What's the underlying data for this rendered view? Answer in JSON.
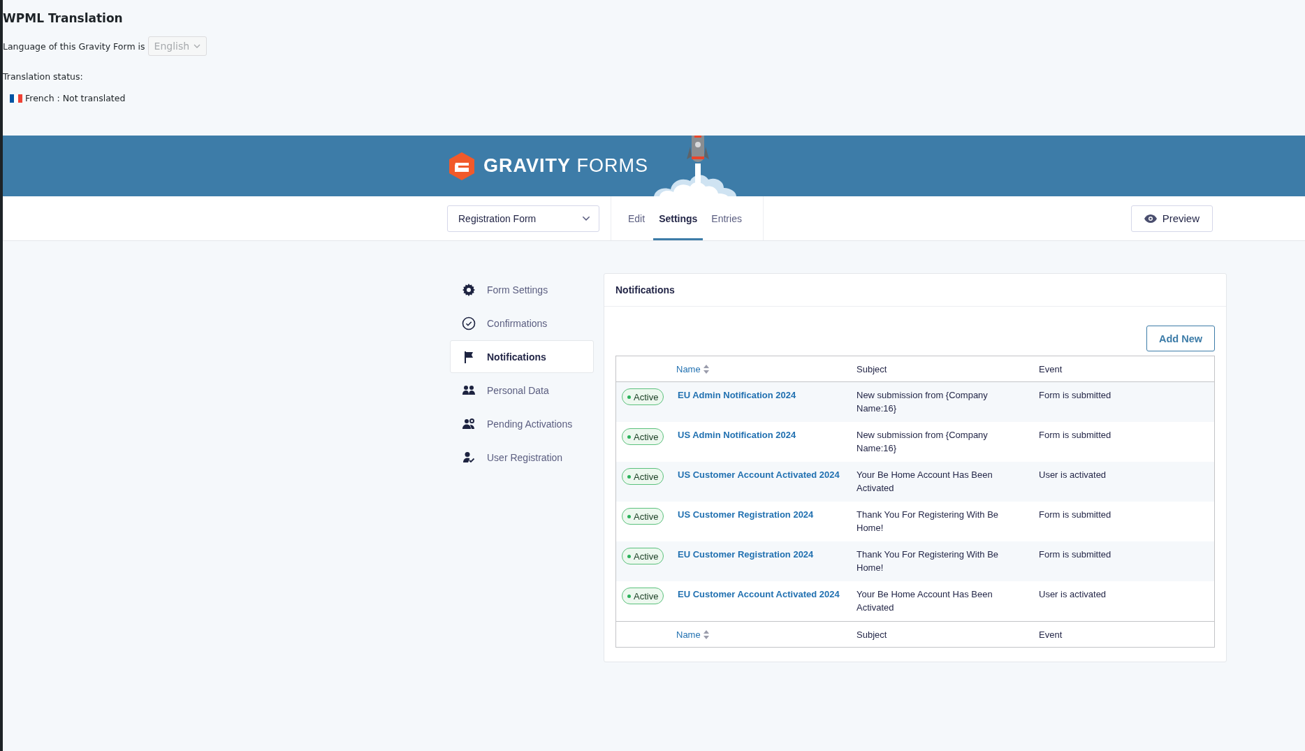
{
  "wpml": {
    "title": "WPML Translation",
    "language_label": "Language of this Gravity Form is",
    "language_select": {
      "value": "English",
      "disabled": true
    },
    "status_label": "Translation status:",
    "translations": [
      {
        "label": "French : Not translated"
      }
    ]
  },
  "header": {
    "logo_bold": "GRAVITY",
    "logo_light": "FORMS"
  },
  "toolbar": {
    "form_select": "Registration Form",
    "tabs": [
      {
        "label": "Edit",
        "selected": false
      },
      {
        "label": "Settings",
        "selected": true
      },
      {
        "label": "Entries",
        "selected": false
      }
    ],
    "preview": "Preview"
  },
  "sidebar": {
    "items": [
      {
        "label": "Form Settings",
        "kind": "gear",
        "selected": false
      },
      {
        "label": "Confirmations",
        "kind": "check",
        "selected": false
      },
      {
        "label": "Notifications",
        "kind": "flag",
        "selected": true
      },
      {
        "label": "Personal Data",
        "kind": "people",
        "selected": false
      },
      {
        "label": "Pending Activations",
        "kind": "people-clock",
        "selected": false
      },
      {
        "label": "User Registration",
        "kind": "user-check",
        "selected": false
      }
    ]
  },
  "panel": {
    "title": "Notifications",
    "add_button": "Add New",
    "columns": [
      "Name",
      "Subject",
      "Event"
    ],
    "rows": [
      {
        "status": "Active",
        "active": true,
        "name": "EU Admin Notification 2024",
        "subject": "New submission from {Company Name:16}",
        "event": "Form is submitted"
      },
      {
        "status": "Active",
        "active": true,
        "name": "US Admin Notification 2024",
        "subject": "New submission from {Company Name:16}",
        "event": "Form is submitted"
      },
      {
        "status": "Active",
        "active": true,
        "name": "US Customer Account Activated 2024",
        "subject": "Your Be Home Account Has Been Activated",
        "event": "User is activated"
      },
      {
        "status": "Active",
        "active": true,
        "name": "US Customer Registration 2024",
        "subject": "Thank You For Registering With Be Home!",
        "event": "Form is submitted"
      },
      {
        "status": "Active",
        "active": true,
        "name": "EU Customer Registration 2024",
        "subject": "Thank You For Registering With Be Home!",
        "event": "Form is submitted"
      },
      {
        "status": "Active",
        "active": true,
        "name": "EU Customer Account Activated 2024",
        "subject": "Your Be Home Account Has Been Activated",
        "event": "User is activated"
      }
    ],
    "footer_columns": [
      "Name",
      "Subject",
      "Event"
    ]
  }
}
